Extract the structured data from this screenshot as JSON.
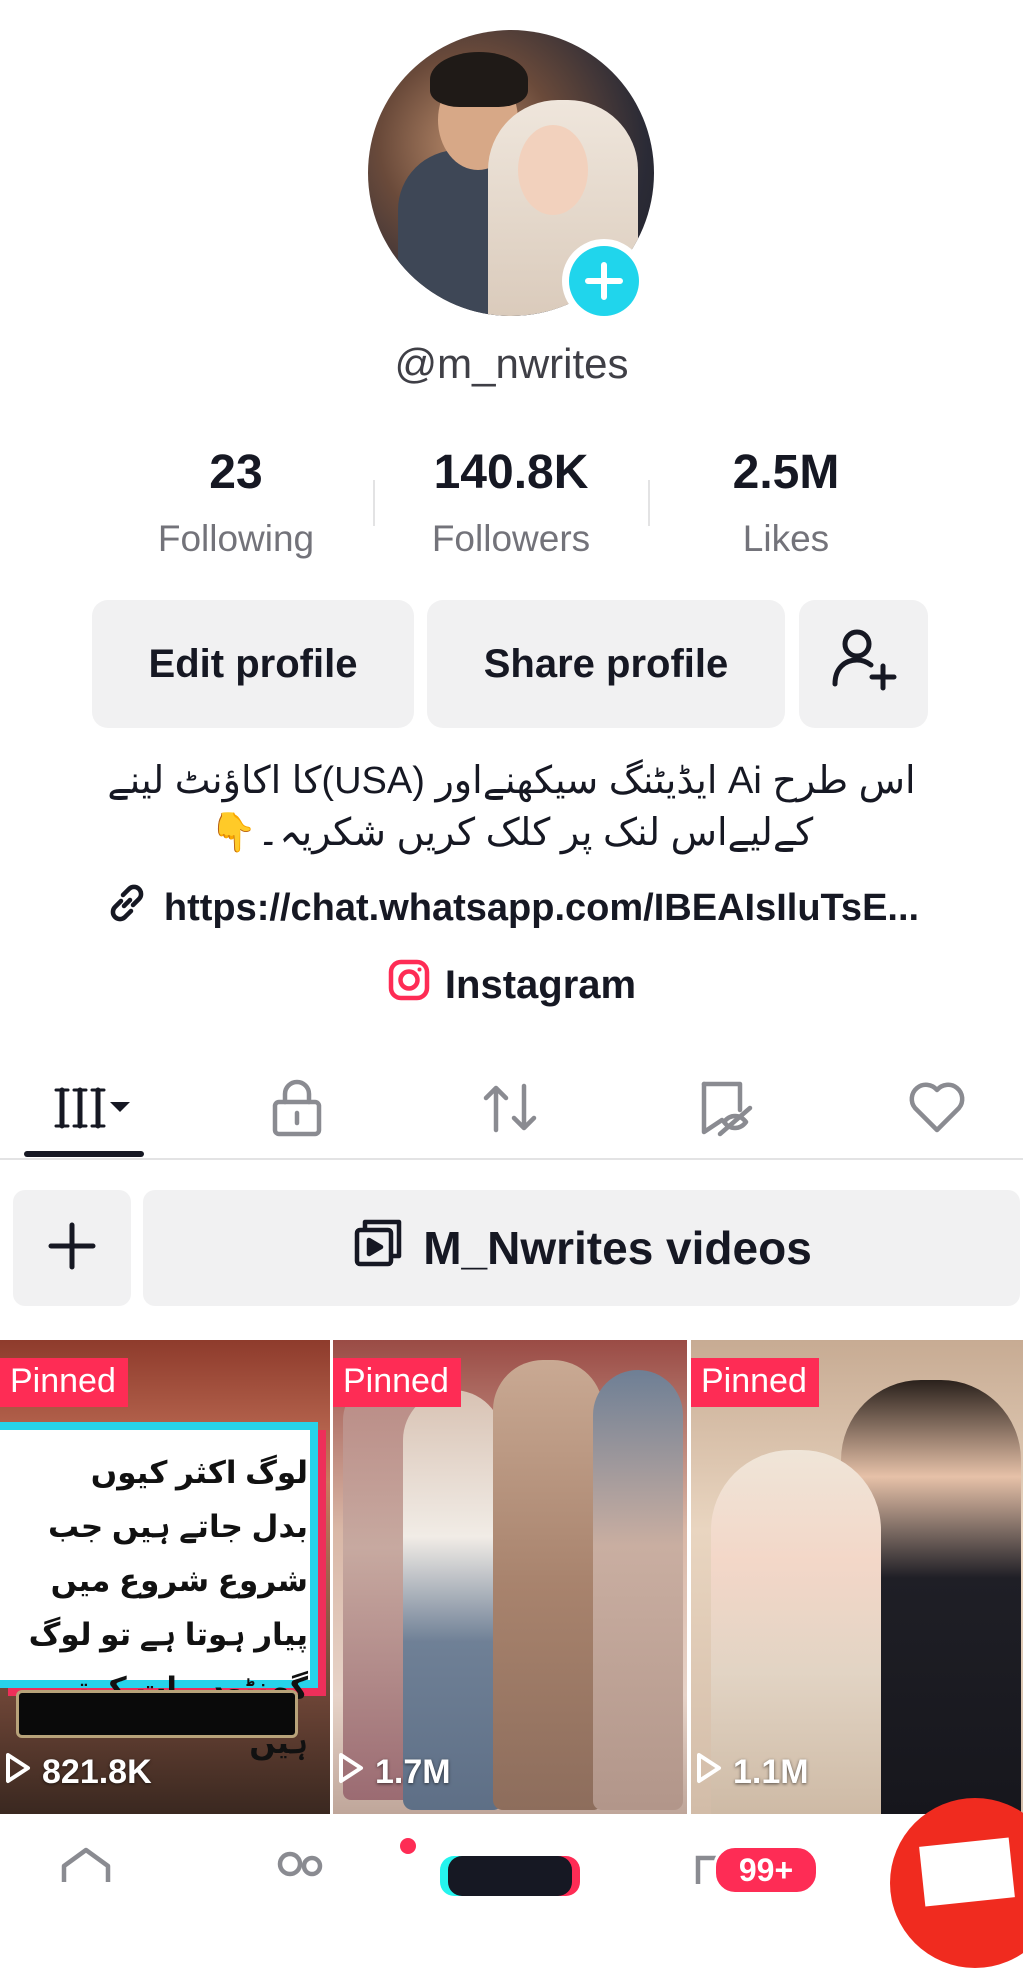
{
  "profile": {
    "username": "@m_nwrites"
  },
  "stats": {
    "following": {
      "value": "23",
      "label": "Following"
    },
    "followers": {
      "value": "140.8K",
      "label": "Followers"
    },
    "likes": {
      "value": "2.5M",
      "label": "Likes"
    }
  },
  "actions": {
    "edit_label": "Edit profile",
    "share_label": "Share profile"
  },
  "bio": {
    "line1": "اس طرح Ai ایڈیٹنگ سیکھنےاور (USA)کا اکاؤنٹ لینے",
    "line2": "کےلیےاس لنک پر کلک کریں شکریہ۔👇",
    "link": "https://chat.whatsapp.com/IBEAIsIluTsE...",
    "instagram": "Instagram"
  },
  "playlist": {
    "label": "M_Nwrites videos"
  },
  "videos": [
    {
      "pinned": "Pinned",
      "views": "821.8K",
      "caption": "لوگ اکثر کیوں بدل جاتے ہیں جب شروع شروع میں پیار ہوتا ہے تو لوگ گھنٹوں بات کرتے ہیں"
    },
    {
      "pinned": "Pinned",
      "views": "1.7M"
    },
    {
      "pinned": "Pinned",
      "views": "1.1M"
    }
  ],
  "nav": {
    "inbox_badge": "99+"
  },
  "colors": {
    "accent": "#fe2c55",
    "cyan": "#20d5ec",
    "button_bg": "#f1f1f2"
  },
  "icons": {
    "add_friend": "person-plus-icon",
    "link": "link-icon",
    "instagram": "instagram-icon",
    "tab_videos": "grid-icon",
    "tab_private": "lock-icon",
    "tab_reposts": "repost-icon",
    "tab_favorites": "bookmark-hidden-icon",
    "tab_liked": "heart-icon"
  }
}
